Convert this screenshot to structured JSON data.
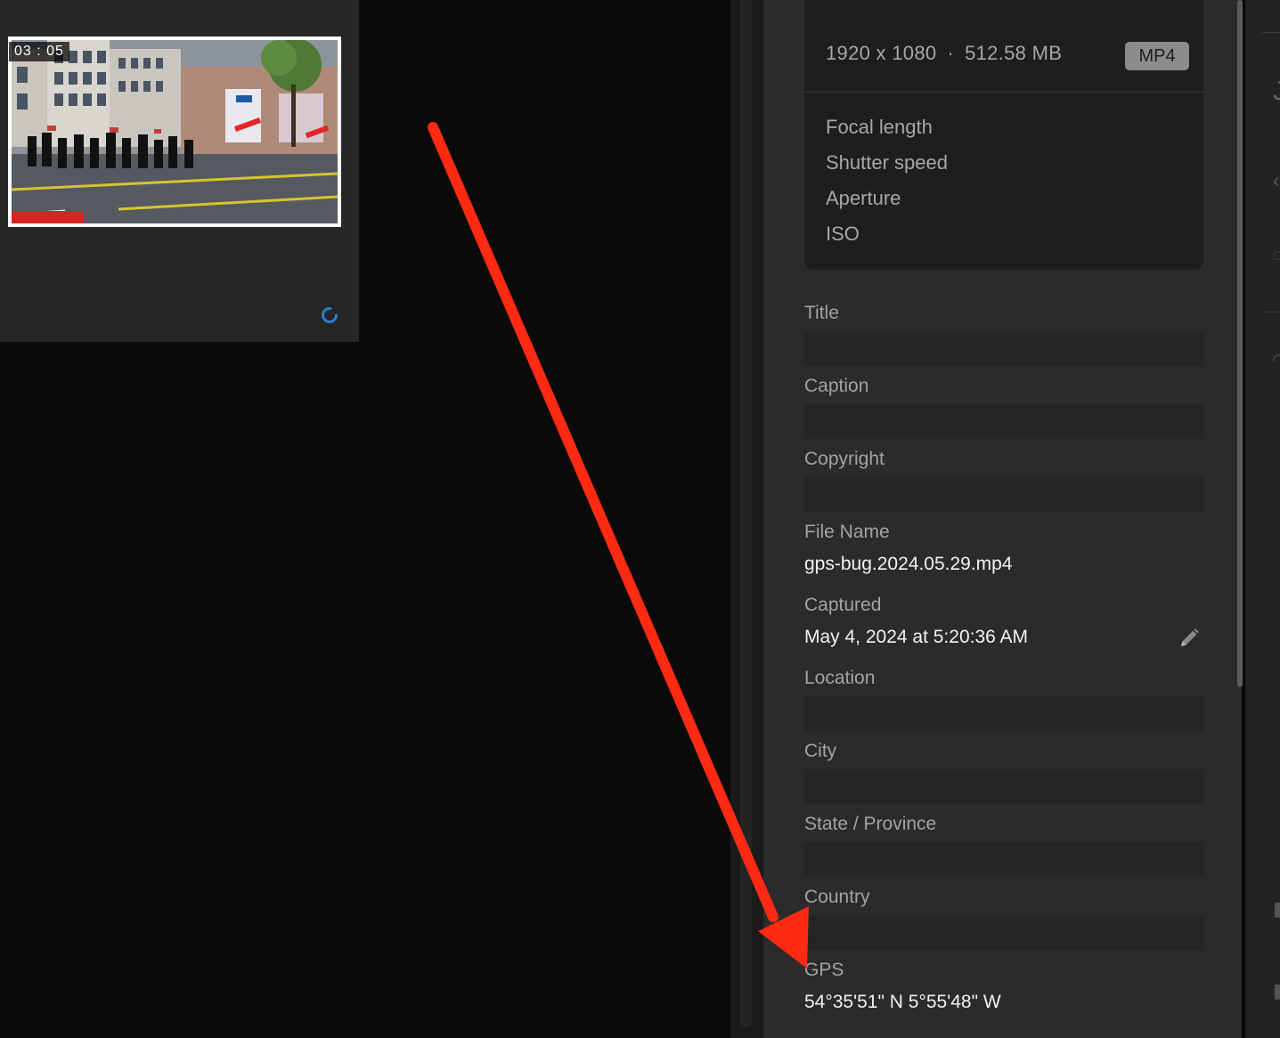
{
  "thumbnail": {
    "duration": "03 : 05"
  },
  "file_info": {
    "dimensions": "1920 x 1080",
    "separator": "·",
    "size": "512.58 MB",
    "format": "MP4"
  },
  "exif": [
    "Focal length",
    "Shutter speed",
    "Aperture",
    "ISO"
  ],
  "fields": {
    "title": {
      "label": "Title",
      "value": ""
    },
    "caption": {
      "label": "Caption",
      "value": ""
    },
    "copyright": {
      "label": "Copyright",
      "value": ""
    },
    "file_name": {
      "label": "File Name",
      "value": "gps-bug.2024.05.29.mp4"
    },
    "captured": {
      "label": "Captured",
      "value": "May 4, 2024 at 5:20:36 AM"
    },
    "location": {
      "label": "Location",
      "value": ""
    },
    "city": {
      "label": "City",
      "value": ""
    },
    "state": {
      "label": "State / Province",
      "value": ""
    },
    "country": {
      "label": "Country",
      "value": ""
    },
    "gps": {
      "label": "GPS",
      "value": "54°35'51\" N 5°55'48\" W"
    }
  },
  "colors": {
    "annotation": "#ff2a12",
    "spinner": "#2b7cd3",
    "panel": "#2b2b2b"
  }
}
